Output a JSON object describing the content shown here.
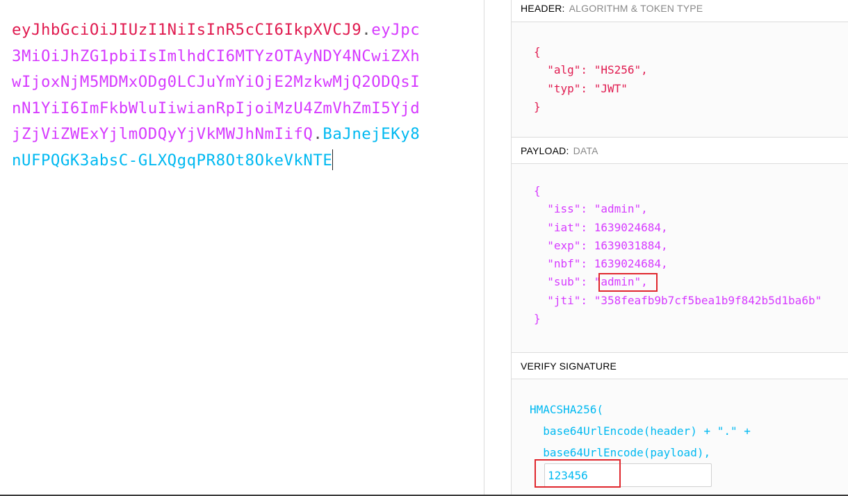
{
  "encoded": {
    "header_part": "eyJhbGciOiJIUzI1NiIsInR5cCI6IkpXVCJ9",
    "payload_part": "eyJpc3MiOiJhZG1pbiIsImlhdCI6MTYzOTAyNDY4NCwiZXhwIjoxNjM5MDMxODg0LCJuYmYiOjE2MzkwMjQ2ODQsInN1YiI6ImFkbWluIiwianRpIjoiMzU4ZmVhZmI5YjdjZjViZWExYjlmODQyYjVkMWJhNmIifQ",
    "signature_part": "BaJnejEKy8nUFPQGK3absC-GLXQgqPR8Ot8OkeVkNTE",
    "dot": "."
  },
  "header_panel": {
    "title": "HEADER:",
    "subtitle": "ALGORITHM & TOKEN TYPE",
    "lines": [
      "{",
      "  \"alg\": \"HS256\",",
      "  \"typ\": \"JWT\"",
      "}"
    ]
  },
  "payload_panel": {
    "title": "PAYLOAD:",
    "subtitle": "DATA",
    "lines": [
      "{",
      "  \"iss\": \"admin\",",
      "  \"iat\": 1639024684,",
      "  \"exp\": 1639031884,",
      "  \"nbf\": 1639024684,",
      "  \"sub\": \"admin\",",
      "  \"jti\": \"358feafb9b7cf5bea1b9f842b5d1ba6b\"",
      "}"
    ]
  },
  "signature_panel": {
    "title": "VERIFY SIGNATURE",
    "lines": [
      "HMACSHA256(",
      "  base64UrlEncode(header) + \".\" +",
      "  base64UrlEncode(payload),"
    ],
    "secret_value": "123456"
  },
  "colors": {
    "header": "#e01a4f",
    "payload": "#d63aff",
    "signature": "#00b9f1",
    "highlight": "#e0262c"
  }
}
